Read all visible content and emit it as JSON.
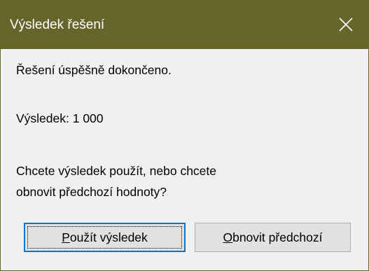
{
  "window": {
    "title": "Výsledek řešení",
    "close_icon": "close-icon"
  },
  "message": {
    "status": "Řešení úspěšně dokončeno.",
    "result": "Výsledek: 1 000",
    "question_line1": "Chcete výsledek použít, nebo chcete",
    "question_line2": "obnovit předchozí hodnoty?"
  },
  "buttons": {
    "use_result": {
      "mnemonic": "P",
      "rest": "oužít výsledek"
    },
    "restore_previous": {
      "mnemonic": "O",
      "rest": "bnovit předchozí"
    }
  },
  "colors": {
    "titlebar": "#66652b",
    "titlebar_text": "#ffffff",
    "dialog_bg": "#f0f0f0",
    "button_bg": "#e1e1e1",
    "button_focus_border": "#0078d7"
  }
}
